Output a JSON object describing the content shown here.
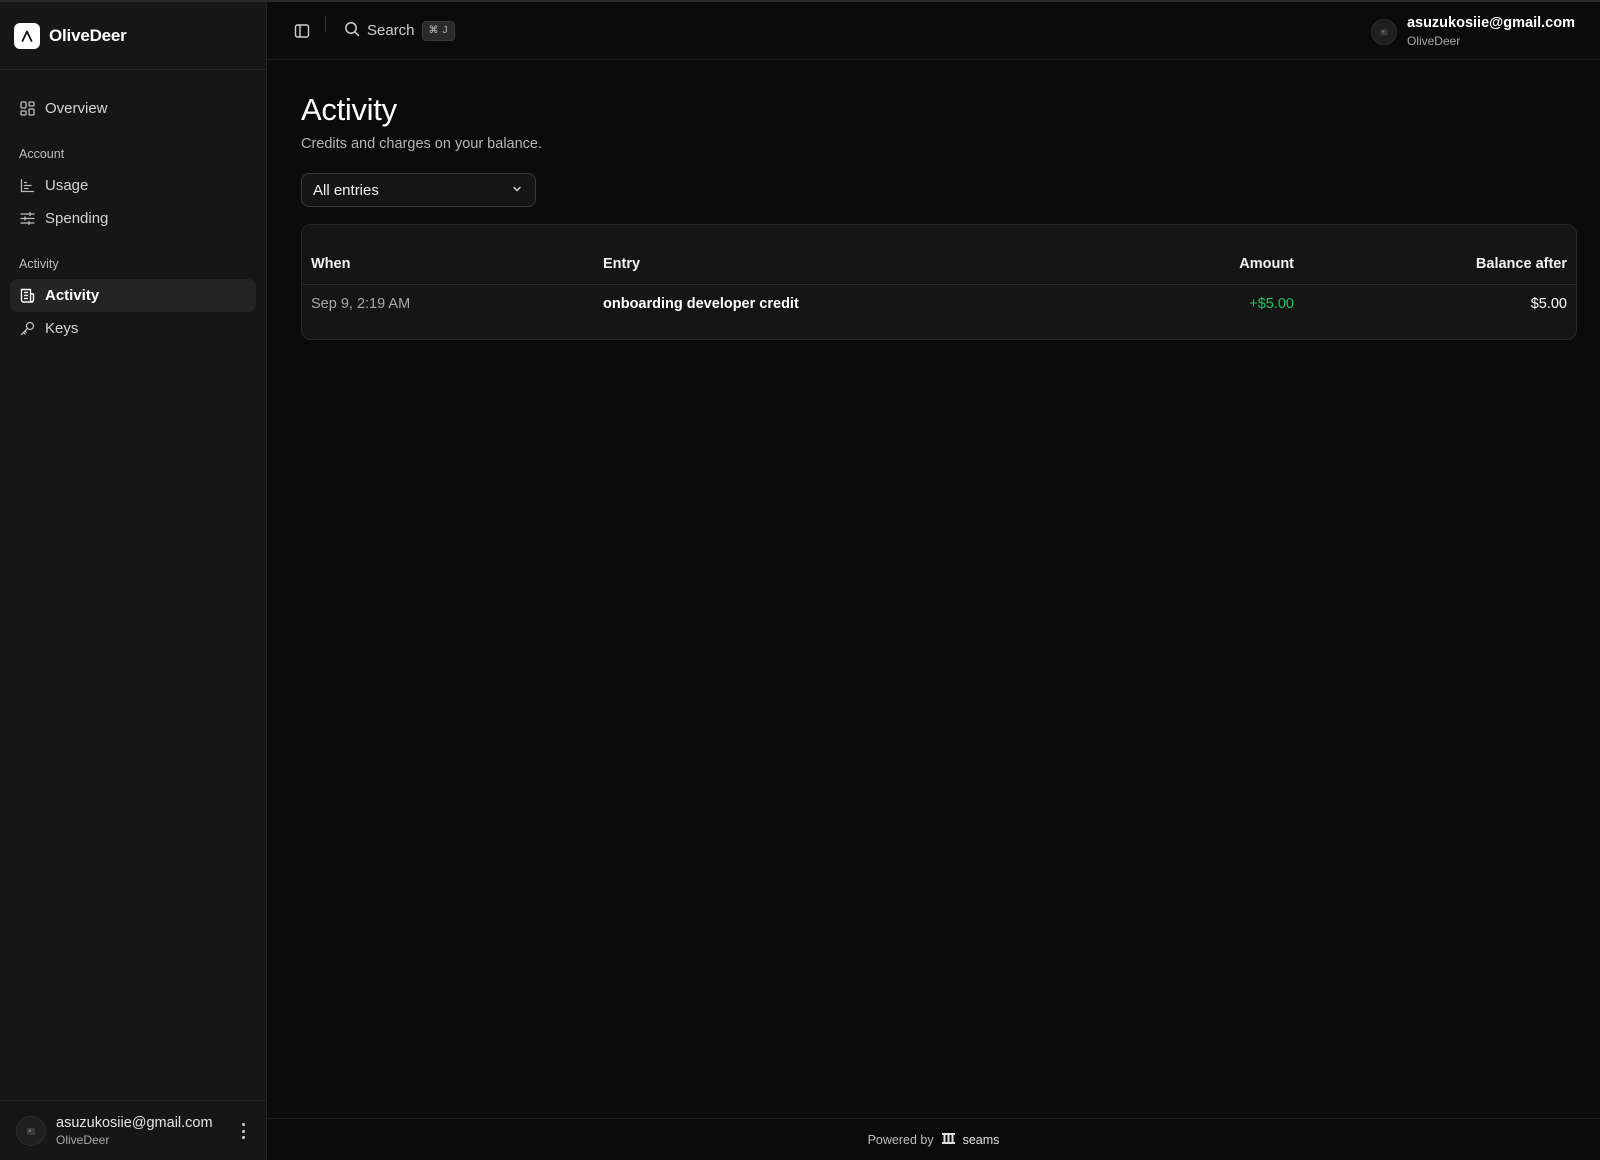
{
  "app": {
    "name": "OliveDeer"
  },
  "sidebar": {
    "items": [
      {
        "label": "Overview",
        "icon": "grid-icon"
      }
    ],
    "groups": [
      {
        "title": "Account",
        "items": [
          {
            "label": "Usage",
            "icon": "chart-icon"
          },
          {
            "label": "Spending",
            "icon": "sliders-icon"
          }
        ]
      },
      {
        "title": "Activity",
        "items": [
          {
            "label": "Activity",
            "icon": "receipt-icon",
            "active": true
          },
          {
            "label": "Keys",
            "icon": "key-icon"
          }
        ]
      }
    ],
    "footer": {
      "email": "asuzukosiie@gmail.com",
      "org": "OliveDeer"
    }
  },
  "header": {
    "search_label": "Search",
    "shortcut_symbol": "⌘",
    "shortcut_key": "J",
    "user": {
      "email": "asuzukosiie@gmail.com",
      "org": "OliveDeer"
    }
  },
  "main": {
    "title": "Activity",
    "subtitle": "Credits and charges on your balance.",
    "filter": {
      "selected": "All entries"
    },
    "table": {
      "columns": {
        "when": "When",
        "entry": "Entry",
        "amount": "Amount",
        "balance": "Balance after"
      },
      "rows": [
        {
          "when": "Sep 9, 2:19 AM",
          "entry": "onboarding developer credit",
          "amount": "+$5.00",
          "balance": "$5.00"
        }
      ]
    }
  },
  "footer": {
    "powered_by": "Powered by",
    "brand": "seams"
  },
  "colors": {
    "background": "#0b0b0b",
    "sidebar": "#161616",
    "positive": "#22c55e"
  }
}
